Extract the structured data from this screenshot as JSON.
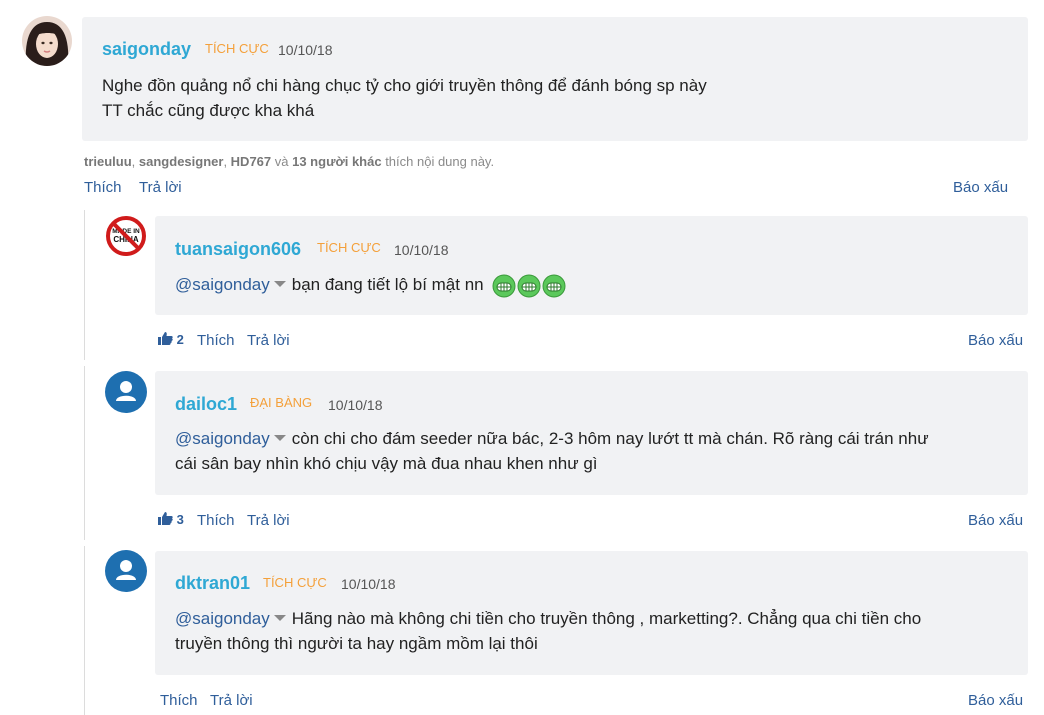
{
  "comments": {
    "main": {
      "username": "saigonday",
      "rank": "TÍCH CỰC",
      "date": "10/10/18",
      "line1": "Nghe đồn quảng nổ chi hàng chục tỷ cho giới truyền thông để đánh bóng sp này",
      "line2": "TT chắc cũng được kha khá",
      "likers": {
        "u1": "trieuluu",
        "sep1": ", ",
        "u2": "sangdesigner",
        "sep2": ", ",
        "u3": "HD767",
        "and": " và ",
        "others": "13 người khác",
        "suffix": " thích nội dung này."
      },
      "like_label": "Thích",
      "reply_label": "Trả lời",
      "report_label": "Báo xấu"
    },
    "reply1": {
      "username": "tuansaigon606",
      "rank": "TÍCH CỰC",
      "date": "10/10/18",
      "mention": "@saigonday",
      "text": "bạn đang tiết lộ bí mật nn",
      "like_count": "2",
      "like_label": "Thích",
      "reply_label": "Trả lời",
      "report_label": "Báo xấu",
      "avatar_text": "MADE IN CHINA"
    },
    "reply2": {
      "username": "dailoc1",
      "rank": "ĐẠI BÀNG",
      "date": "10/10/18",
      "mention": "@saigonday",
      "line1": "còn chi cho đám seeder nữa bác, 2-3 hôm nay lướt tt mà chán. Rõ ràng cái trán như",
      "line2": "cái sân bay nhìn khó chịu vậy mà đua nhau khen như gì",
      "like_count": "3",
      "like_label": "Thích",
      "reply_label": "Trả lời",
      "report_label": "Báo xấu"
    },
    "reply3": {
      "username": "dktran01",
      "rank": "TÍCH CỰC",
      "date": "10/10/18",
      "mention": "@saigonday",
      "line1": "Hãng nào mà không chi tiền cho truyền thông , marketting?. Chẳng qua chi tiền cho",
      "line2": "truyền thông thì người ta hay ngầm mồm lại thôi",
      "like_label": "Thích",
      "reply_label": "Trả lời",
      "report_label": "Báo xấu"
    }
  },
  "colors": {
    "username": "#2fa8d4",
    "rank": "#f4a03a",
    "link": "#2f5e9a",
    "bubble": "#f1f2f4",
    "avatar_default": "#1e6fb0"
  },
  "icons": {
    "like": "thumbs-up-icon",
    "mention_menu": "chevron-down-icon",
    "default_avatar": "user-icon",
    "emoji": "grinning-face-icon"
  }
}
